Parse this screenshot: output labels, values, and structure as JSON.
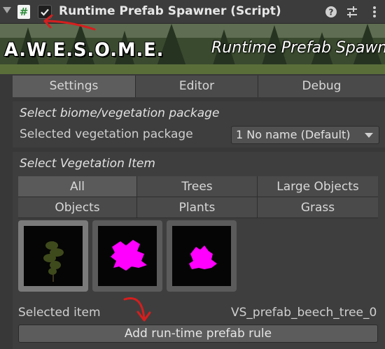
{
  "header": {
    "title": "Runtime Prefab Spawner (Script)",
    "script_icon_glyph": "#",
    "enabled": true,
    "icons": [
      "help-icon",
      "settings-sliders-icon",
      "more-options-icon"
    ]
  },
  "banner": {
    "logo": "A.W.E.S.O.M.E.",
    "text": "Runtime Prefab Spawn"
  },
  "tabs": [
    {
      "label": "Settings",
      "active": true
    },
    {
      "label": "Editor",
      "active": false
    },
    {
      "label": "Debug",
      "active": false
    }
  ],
  "biome_section": {
    "title": "Select biome/vegetation package",
    "field_label": "Selected vegetation package",
    "dropdown_value": "1 No name (Default)"
  },
  "vegetation_section": {
    "title": "Select Vegetation Item",
    "filters": [
      {
        "label": "All",
        "active": true
      },
      {
        "label": "Trees",
        "active": false
      },
      {
        "label": "Large Objects",
        "active": false
      },
      {
        "label": "Objects",
        "active": false
      },
      {
        "label": "Plants",
        "active": false
      },
      {
        "label": "Grass",
        "active": false
      }
    ],
    "thumbnails": [
      "tree-thumbnail",
      "magenta-plant-thumbnail",
      "magenta-grass-thumbnail"
    ],
    "selected_label": "Selected item",
    "selected_value": "VS_prefab_beech_tree_0",
    "add_button": "Add run-time prefab rule"
  },
  "colors": {
    "background": "#383838",
    "missing_texture": "#ff00ff",
    "annotation_arrow": "#d61e1e"
  }
}
